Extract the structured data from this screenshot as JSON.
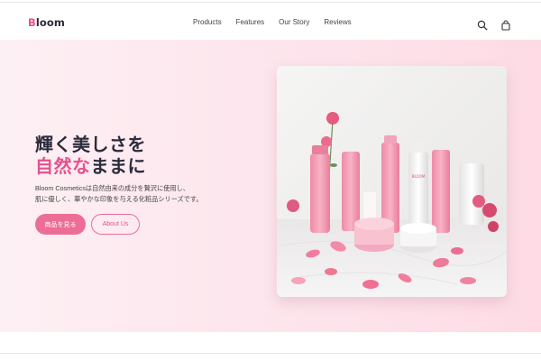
{
  "brand": {
    "first_letter": "B",
    "rest": "loom"
  },
  "nav": {
    "items": [
      {
        "label": "Products"
      },
      {
        "label": "Features"
      },
      {
        "label": "Our Story"
      },
      {
        "label": "Reviews"
      }
    ]
  },
  "icons": {
    "search": "search-icon",
    "bag": "shopping-bag-icon"
  },
  "hero": {
    "headline_line1": "輝く美しさを",
    "headline_pink": "自然な",
    "headline_rest": "ままに",
    "description_line1": "Bloom Cosmeticsは自然由来の成分を贅沢に使用し、",
    "description_line2": "肌に優しく、華やかな印象を与える化粧品シリーズです。",
    "primary_button": "商品を見る",
    "secondary_button": "About Us"
  },
  "product_labels": {
    "bottle": "BLOOM"
  },
  "colors": {
    "accent": "#e8508d",
    "button": "#ec6e97",
    "text_dark": "#2b2b3a"
  }
}
